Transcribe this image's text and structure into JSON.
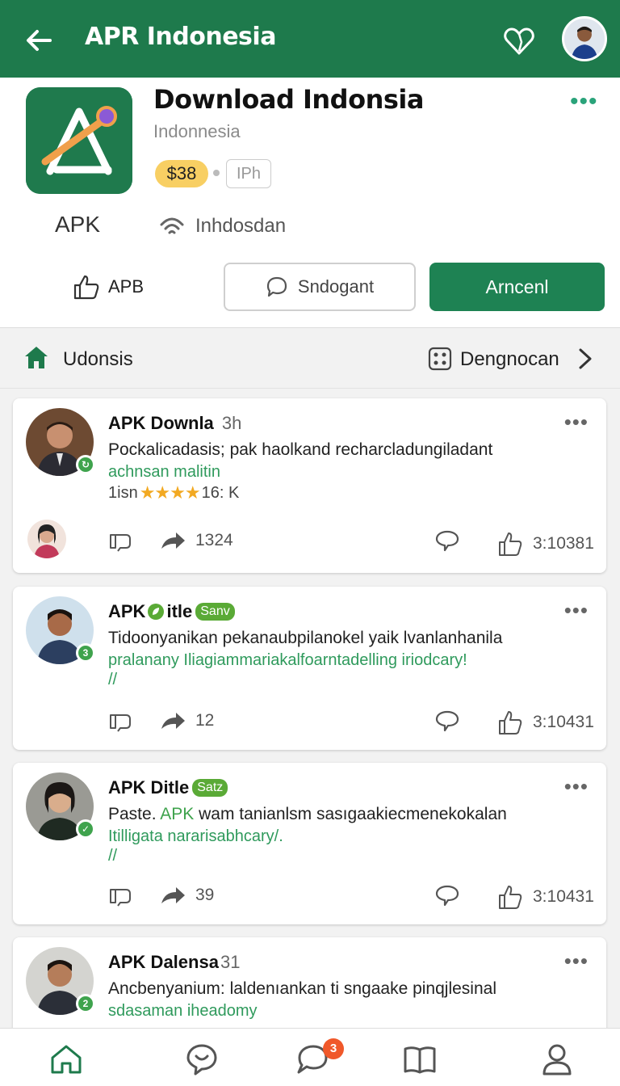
{
  "appbar": {
    "title": "APR Indonesia"
  },
  "app": {
    "name": "Download Indonsia",
    "developer": "Indonnesia",
    "price": "$38",
    "platform_badge": "IPh",
    "type_label": "APK",
    "source_label": "Inhdosdan",
    "like_label": "APB",
    "search_label": "Sndogant",
    "primary_label": "Arncenl"
  },
  "filter": {
    "home_label": "Udonsis",
    "sort_label": "Dengnocan"
  },
  "posts": [
    {
      "author": "APK Downla",
      "time": "3h",
      "body": "Pockalicadasis; pak haolkand recharcladungiladant",
      "sub": "achnsan malitin",
      "rating_prefix": "1isn",
      "stars": "★★★★",
      "rating_count": "16: K",
      "share_count": "1324",
      "like_count": "3:10381"
    },
    {
      "author": "APK",
      "author_suffix": "itle",
      "tag": "Sanv",
      "badge": "3",
      "body": "Tidoonyanikan pekanaubpilanokel yaik lvanlanhanila",
      "sub": "pralanany Iliagiammariakalfoarntadelling iriodcary!",
      "sub2": "//",
      "share_count": "12",
      "like_count": "3:10431"
    },
    {
      "author": "APK Ditle",
      "tag": "Satz",
      "body_prefix": "Paste.",
      "body_highlight": "APK",
      "body_rest": "wam tanianlsm sasıgaakiecmenekokalan",
      "sub": "Itilligata nararisabhcary/.",
      "sub2": "//",
      "share_count": "39",
      "like_count": "3:10431"
    },
    {
      "author": "APK Dalensa",
      "time": "31",
      "badge": "2",
      "body": "Ancbenyanium: laldenıankan ti sngaake pinqjlesinal",
      "sub": "sdasaman iheadomy"
    }
  ],
  "nav": {
    "chat_badge": "3"
  },
  "colors": {
    "primary": "#1e7a4c",
    "accent": "#2f9a5c",
    "star": "#f2a922",
    "badge": "#f0582a",
    "price": "#f8cf63"
  }
}
